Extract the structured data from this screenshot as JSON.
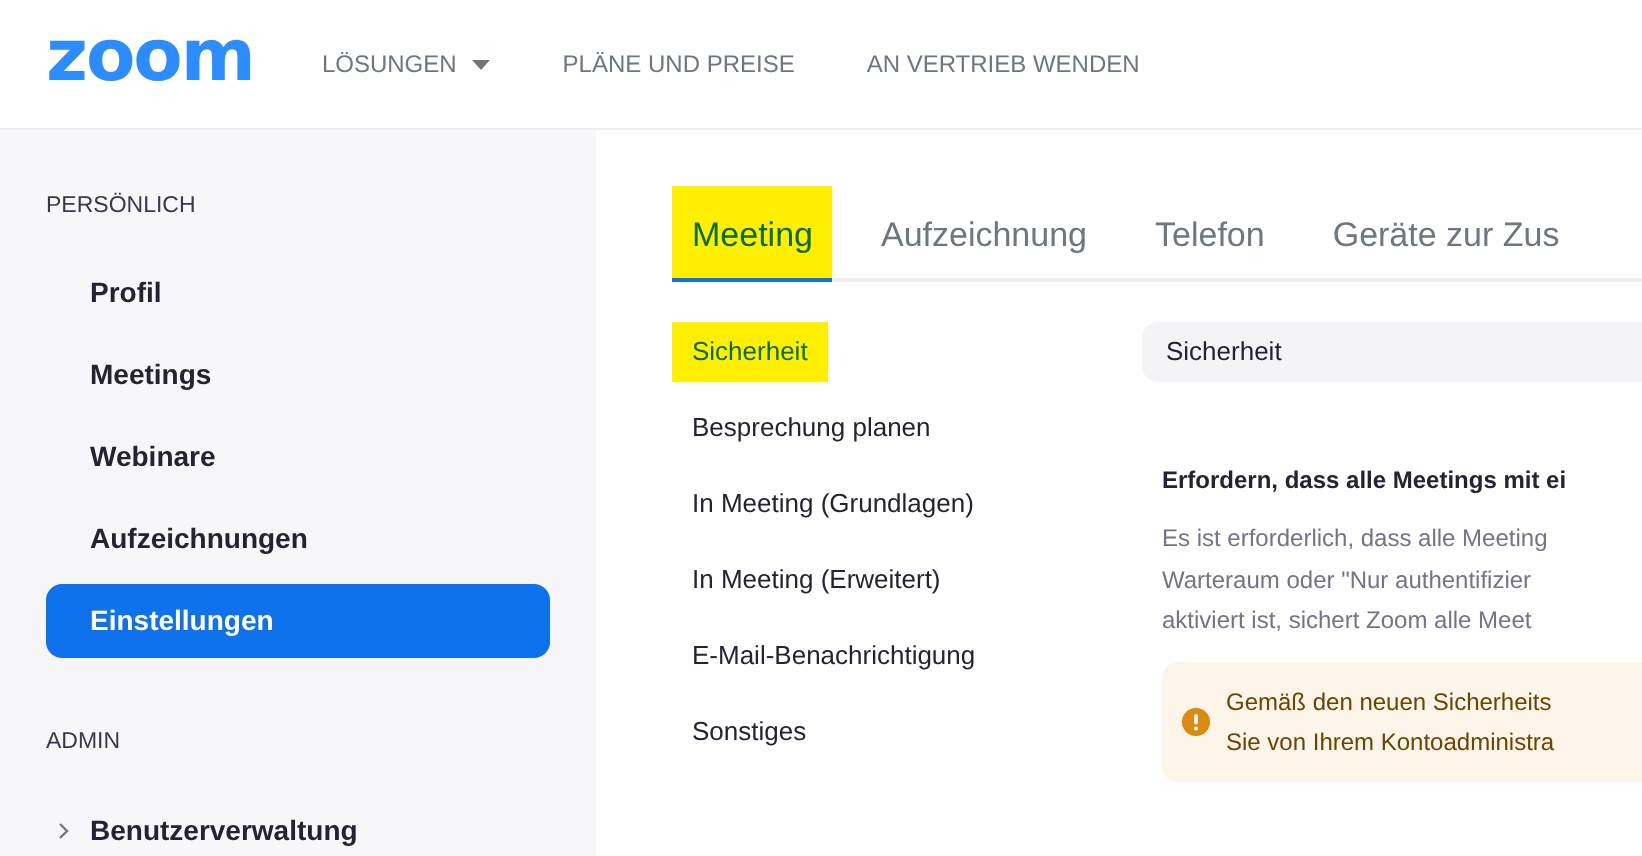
{
  "header": {
    "logo": "zoom",
    "nav": [
      {
        "label": "LÖSUNGEN",
        "dropdown": true
      },
      {
        "label": "PLÄNE UND PREISE",
        "dropdown": false
      },
      {
        "label": "AN VERTRIEB WENDEN",
        "dropdown": false
      }
    ]
  },
  "sidebar": {
    "sections": [
      {
        "title": "PERSÖNLICH",
        "items": [
          {
            "label": "Profil",
            "selected": false,
            "expandable": false
          },
          {
            "label": "Meetings",
            "selected": false,
            "expandable": false
          },
          {
            "label": "Webinare",
            "selected": false,
            "expandable": false
          },
          {
            "label": "Aufzeichnungen",
            "selected": false,
            "expandable": false
          },
          {
            "label": "Einstellungen",
            "selected": true,
            "expandable": false
          }
        ]
      },
      {
        "title": "ADMIN",
        "items": [
          {
            "label": "Benutzerverwaltung",
            "selected": false,
            "expandable": true
          }
        ]
      }
    ]
  },
  "tabs": [
    {
      "label": "Meeting",
      "selected": true,
      "highlighted": true
    },
    {
      "label": "Aufzeichnung",
      "selected": false,
      "highlighted": false
    },
    {
      "label": "Telefon",
      "selected": false,
      "highlighted": false
    },
    {
      "label": "Geräte zur Zus",
      "selected": false,
      "highlighted": false
    }
  ],
  "subnav": [
    {
      "label": "Sicherheit",
      "highlighted": true
    },
    {
      "label": "Besprechung planen",
      "highlighted": false
    },
    {
      "label": "In Meeting (Grundlagen)",
      "highlighted": false
    },
    {
      "label": "In Meeting (Erweitert)",
      "highlighted": false
    },
    {
      "label": "E-Mail-Benachrichtigung",
      "highlighted": false
    },
    {
      "label": "Sonstiges",
      "highlighted": false
    }
  ],
  "panel": {
    "section_title": "Sicherheit",
    "setting_title": "Erfordern, dass alle Meetings mit ei",
    "description_lines": [
      "Es ist erforderlich, dass alle Meeting",
      "Warteraum oder \"Nur authentifizier",
      "aktiviert ist, sichert Zoom alle Meet"
    ],
    "warning_lines": [
      "Gemäß den neuen Sicherheits",
      "Sie von Ihrem Kontoadministra"
    ]
  }
}
